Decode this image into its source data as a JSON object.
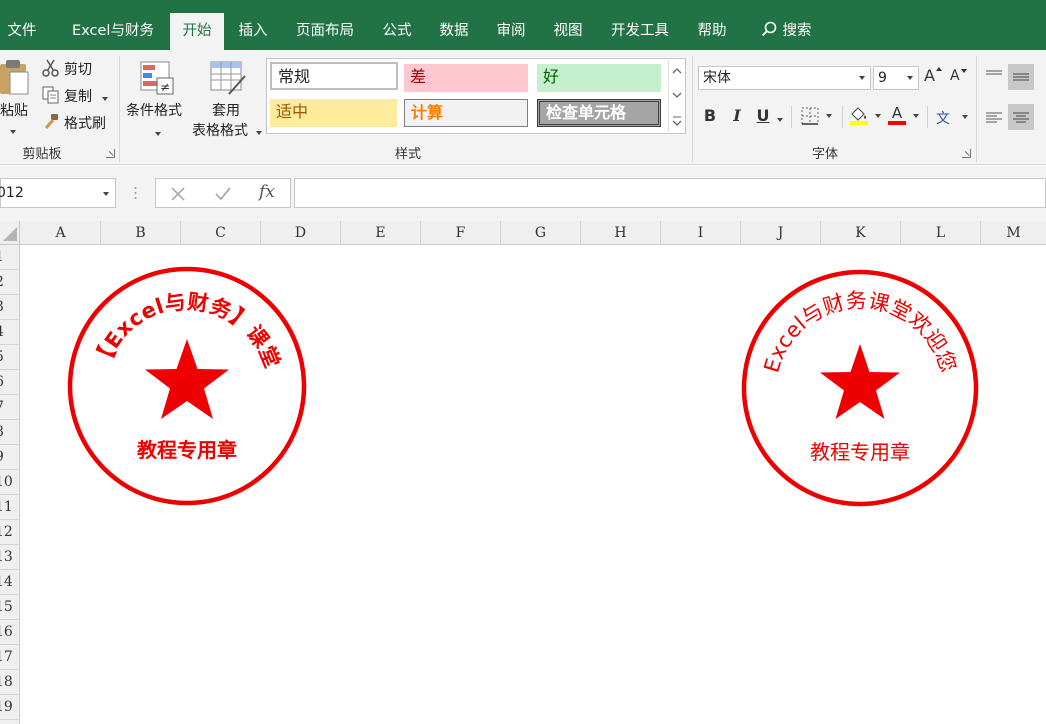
{
  "menu": {
    "tabs": [
      {
        "label": "文件"
      },
      {
        "label": "Excel与财务"
      },
      {
        "label": "开始"
      },
      {
        "label": "插入"
      },
      {
        "label": "页面布局"
      },
      {
        "label": "公式"
      },
      {
        "label": "数据"
      },
      {
        "label": "审阅"
      },
      {
        "label": "视图"
      },
      {
        "label": "开发工具"
      },
      {
        "label": "帮助"
      }
    ],
    "search_label": "搜索",
    "active_tab": "开始",
    "bar_color": "#217346"
  },
  "ribbon": {
    "clipboard": {
      "paste": "粘贴",
      "cut": "剪切",
      "copy": "复制",
      "format_painter": "格式刷",
      "group_label": "剪贴板"
    },
    "styles": {
      "conditional_format": "条件格式",
      "table_format_1": "套用",
      "table_format_2": "表格格式",
      "cells": [
        {
          "label": "常规",
          "bg": "#ffffff",
          "color": "#222222"
        },
        {
          "label": "差",
          "bg": "#ffc7ce",
          "color": "#9c0006"
        },
        {
          "label": "好",
          "bg": "#c6efce",
          "color": "#006100"
        },
        {
          "label": "适中",
          "bg": "#ffeb9c",
          "color": "#9c5700"
        },
        {
          "label": "计算",
          "bg": "#f2f2f2",
          "color": "#fa7d00"
        },
        {
          "label": "检查单元格",
          "bg": "#a5a5a5",
          "color": "#ffffff"
        }
      ],
      "group_label": "样式"
    },
    "font": {
      "font_name": "宋体",
      "font_size": "9",
      "bold": "B",
      "italic": "I",
      "underline": "U",
      "grow": "A",
      "shrink": "A",
      "phonetic": "文",
      "group_label": "字体",
      "font_color": "#ff0000",
      "fill_color": "#ffff00"
    }
  },
  "formula_bar": {
    "name_box": "012",
    "fx": "fx"
  },
  "grid": {
    "columns": [
      "A",
      "B",
      "C",
      "D",
      "E",
      "F",
      "G",
      "H",
      "I",
      "J",
      "K",
      "L",
      "M"
    ],
    "rows": [
      "1",
      "2",
      "3",
      "4",
      "5",
      "6",
      "7",
      "8",
      "9",
      "10",
      "11",
      "12",
      "13",
      "14",
      "15",
      "16",
      "17",
      "18",
      "19"
    ]
  },
  "seals": [
    {
      "arc_text": "【Excel与财务】课堂",
      "bottom_text": "教程专用章",
      "color": "#ee0000",
      "bold": true
    },
    {
      "arc_text": "Excel与财务课堂欢迎您",
      "bottom_text": "教程专用章",
      "color": "#ee0000",
      "bold": false
    }
  ]
}
